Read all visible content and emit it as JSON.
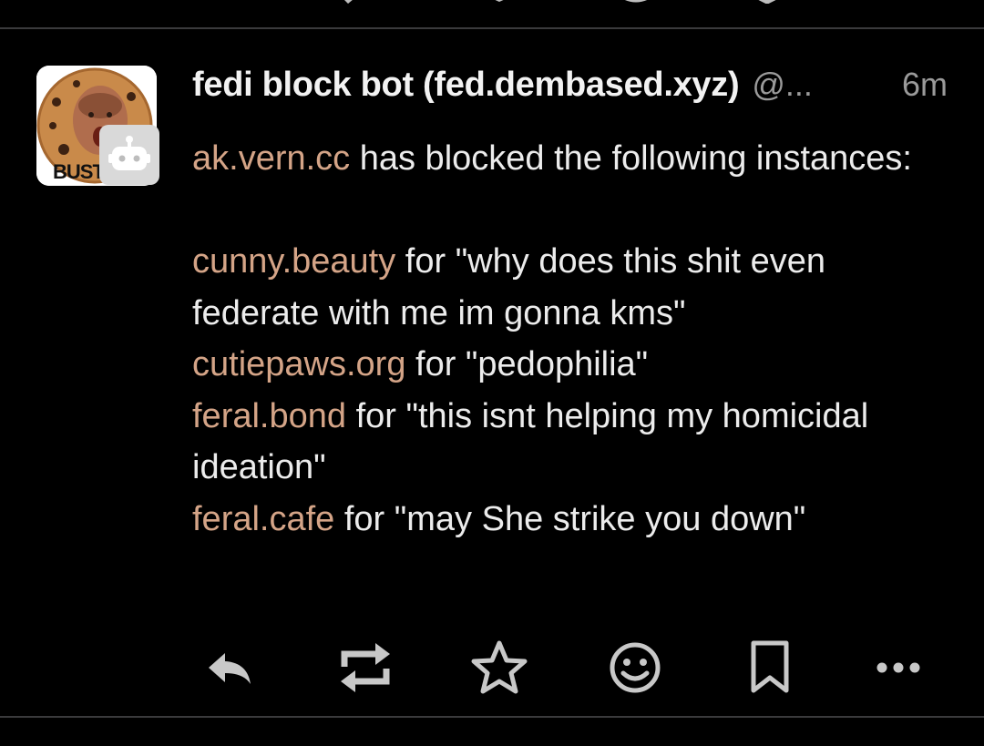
{
  "post": {
    "display_name": "fedi block bot (fed.dembased.xyz)",
    "handle": "@...",
    "timestamp": "6m",
    "avatar": {
      "icon": "cookie-face-avatar",
      "caption": "BUST",
      "badge_icon": "bot-icon"
    },
    "content": {
      "intro": {
        "link": "ak.vern.cc",
        "text": " has blocked the following instances:"
      },
      "entries": [
        {
          "link": "cunny.beauty",
          "text": " for \"why does this shit even federate with me im gonna kms\""
        },
        {
          "link": "cutiepaws.org",
          "text": " for \"pedophilia\""
        },
        {
          "link": "feral.bond",
          "text": " for \"this isnt helping my homicidal ideation\""
        },
        {
          "link": "feral.cafe",
          "text": " for \"may She strike you down\""
        }
      ]
    },
    "actions": [
      "reply-icon",
      "boost-icon",
      "favourite-icon",
      "emoji-react-icon",
      "bookmark-icon",
      "more-icon"
    ]
  },
  "colors": {
    "background": "#000000",
    "link": "#d4a487",
    "text": "#ececec",
    "muted": "#9a9a9a",
    "icon": "#c8c8c8"
  }
}
